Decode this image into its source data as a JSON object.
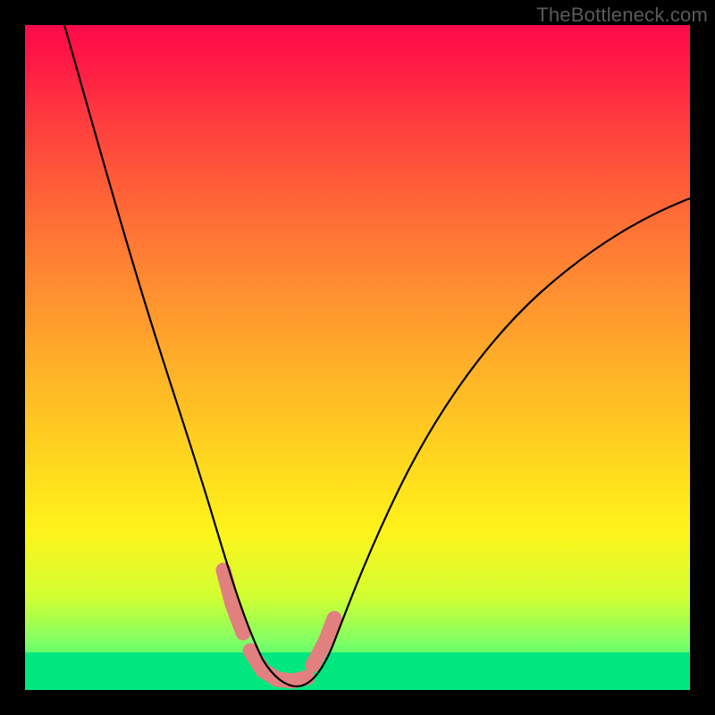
{
  "watermark": "TheBottleneck.com",
  "colors": {
    "frame_top": "#ff0a4a",
    "frame_bottom": "#00e77f",
    "marker": "#e28080",
    "curve": "#000000",
    "background": "#000000"
  },
  "chart_data": {
    "type": "line",
    "title": "",
    "xlabel": "",
    "ylabel": "",
    "xlim": [
      0,
      100
    ],
    "ylim": [
      0,
      100
    ],
    "grid": false,
    "legend": false,
    "series": [
      {
        "name": "bottleneck-curve",
        "x": [
          6,
          10,
          14,
          18,
          22,
          26,
          29,
          31,
          33,
          35,
          37,
          39,
          42,
          46,
          52,
          60,
          70,
          80,
          90,
          100
        ],
        "y": [
          100,
          84,
          70,
          58,
          46,
          34,
          24,
          16,
          10,
          5,
          2,
          1,
          2,
          6,
          14,
          25,
          38,
          49,
          57,
          62
        ]
      }
    ],
    "markers": [
      {
        "name": "left-descent-marker",
        "x_range": [
          29,
          31.5
        ],
        "color": "#e28080"
      },
      {
        "name": "valley-marker",
        "x_range": [
          33,
          40
        ],
        "color": "#e28080"
      },
      {
        "name": "right-ascent-marker",
        "x_range": [
          41.5,
          43.5
        ],
        "color": "#e28080"
      }
    ],
    "annotations": []
  }
}
